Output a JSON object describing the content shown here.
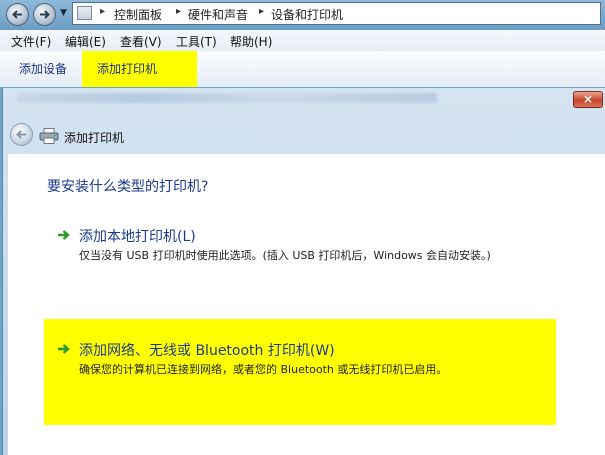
{
  "address_bar": {
    "crumbs": [
      "控制面板",
      "硬件和声音",
      "设备和打印机"
    ]
  },
  "menu": {
    "items": [
      "文件(F)",
      "编辑(E)",
      "查看(V)",
      "工具(T)",
      "帮助(H)"
    ]
  },
  "toolbar": {
    "add_device": "添加设备",
    "add_printer": "添加打印机"
  },
  "wizard": {
    "title": "添加打印机",
    "question": "要安装什么类型的打印机?",
    "option_local": {
      "title": "添加本地打印机(L)",
      "description": "仅当没有 USB 打印机时使用此选项。(插入 USB 打印机后，Windows 会自动安装。)"
    },
    "option_network": {
      "title": "添加网络、无线或 Bluetooth 打印机(W)",
      "description": "确保您的计算机已连接到网络，或者您的 Bluetooth 或无线打印机已启用。"
    }
  },
  "colors": {
    "highlight": "#ffff00",
    "link_text": "#1b3a8c",
    "arrow_green": "#2c9a2a"
  }
}
